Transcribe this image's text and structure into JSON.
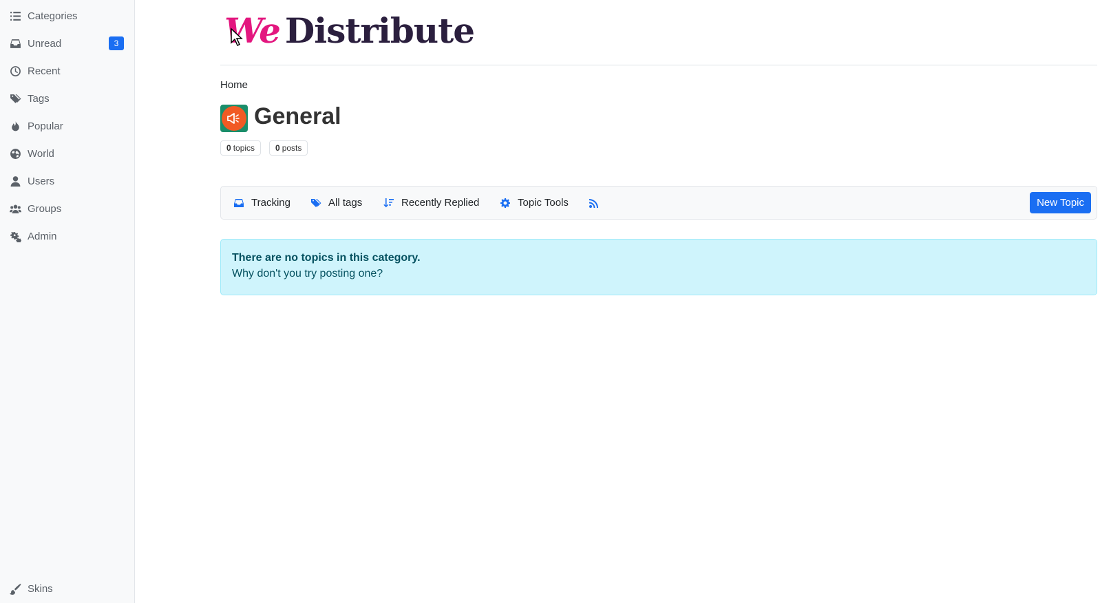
{
  "sidebar": {
    "items": [
      {
        "label": "Categories",
        "icon": "list-icon"
      },
      {
        "label": "Unread",
        "icon": "inbox-icon",
        "badge": "3"
      },
      {
        "label": "Recent",
        "icon": "clock-icon"
      },
      {
        "label": "Tags",
        "icon": "tags-icon"
      },
      {
        "label": "Popular",
        "icon": "fire-icon"
      },
      {
        "label": "World",
        "icon": "globe-icon"
      },
      {
        "label": "Users",
        "icon": "user-icon"
      },
      {
        "label": "Groups",
        "icon": "users-icon"
      },
      {
        "label": "Admin",
        "icon": "gears-icon"
      }
    ],
    "footer": {
      "label": "Skins",
      "icon": "brush-icon"
    }
  },
  "brand": {
    "prefix": "We",
    "name": "Distribute"
  },
  "breadcrumb": {
    "home": "Home"
  },
  "category": {
    "title": "General",
    "icon_bg": "#1a8e6a",
    "icon_fg": "#f15a24",
    "topics_count": "0",
    "topics_label": "topics",
    "posts_count": "0",
    "posts_label": "posts"
  },
  "toolbar": {
    "tracking": "Tracking",
    "all_tags": "All tags",
    "sort": "Recently Replied",
    "topic_tools": "Topic Tools",
    "new_topic": "New Topic",
    "accent": "#1a6ef2"
  },
  "alert": {
    "strong": "There are no topics in this category.",
    "text": "Why don't you try posting one?"
  }
}
